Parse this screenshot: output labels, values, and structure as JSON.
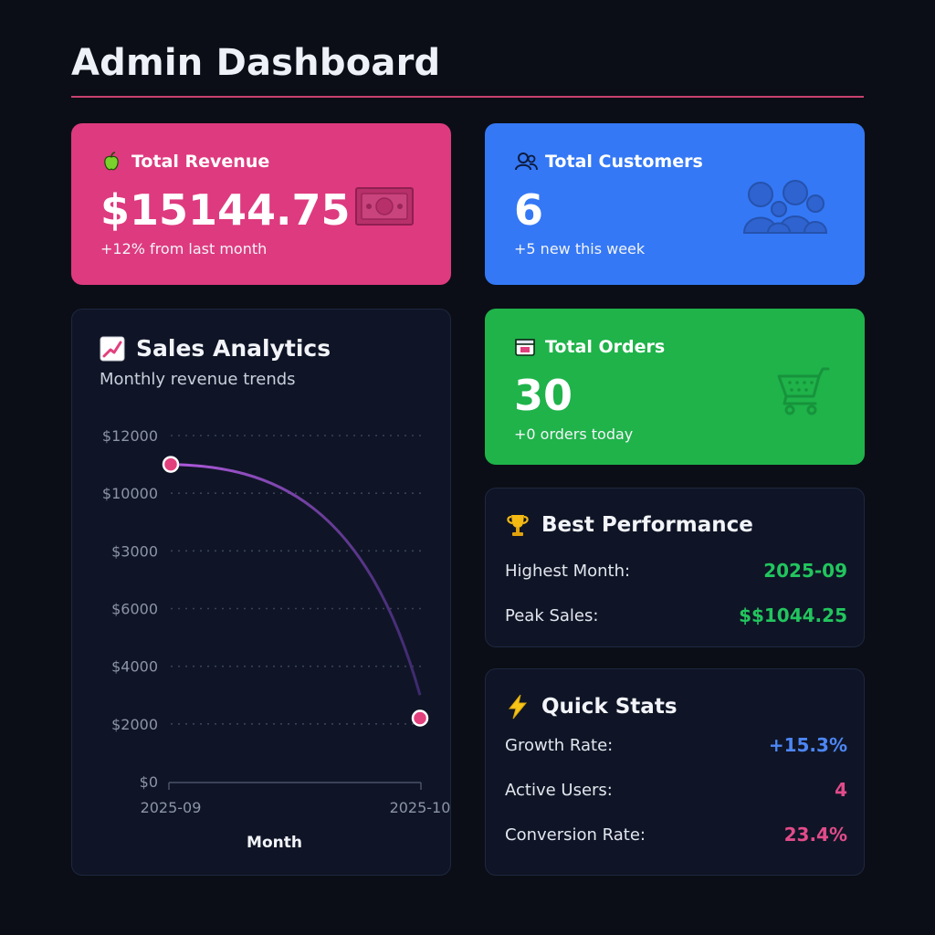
{
  "header": {
    "title": "Admin Dashboard"
  },
  "stats": {
    "revenue": {
      "title": "Total Revenue",
      "value": "$15144.75",
      "note": "+12% from last month",
      "icon": "apple-icon",
      "deco": "money-icon"
    },
    "customers": {
      "title": "Total Customers",
      "value": "6",
      "note": "+5 new this week",
      "icon": "users-icon",
      "deco": "people-group-icon"
    },
    "orders": {
      "title": "Total Orders",
      "value": "30",
      "note": "+0 orders today",
      "icon": "box-icon",
      "deco": "cart-icon"
    }
  },
  "sales": {
    "title": "Sales Analytics",
    "subtitle": "Monthly revenue trends",
    "icon": "chart-icon"
  },
  "chart_data": {
    "type": "line",
    "xlabel": "Month",
    "ylabel": "",
    "categories": [
      "2025-09",
      "2025-10"
    ],
    "y_tick_labels": [
      "$0",
      "$2000",
      "$4000",
      "$6000",
      "$3000",
      "$10000",
      "$12000"
    ],
    "y_ticks": [
      0,
      2000,
      4000,
      6000,
      8000,
      10000,
      12000
    ],
    "ylim": [
      0,
      12000
    ],
    "grid": true,
    "series": [
      {
        "values": [
          11000,
          2200
        ],
        "color": "#a052d6",
        "marker_color": "#e23f7d"
      }
    ]
  },
  "best": {
    "title": "Best Performance",
    "icon": "trophy-icon",
    "rows": [
      {
        "label": "Highest Month:",
        "value": "2025-09"
      },
      {
        "label": "Peak Sales:",
        "value": "$$1044.25"
      }
    ]
  },
  "quick": {
    "title": "Quick Stats",
    "icon": "lightning-icon",
    "rows": [
      {
        "label": "Growth Rate:",
        "value": "+15.3%"
      },
      {
        "label": "Active Users:",
        "value": "4"
      },
      {
        "label": "Conversion Rate:",
        "value": "23.4%"
      }
    ]
  },
  "colors": {
    "background": "#0b0e16",
    "revenue": "#de3a7f",
    "customers": "#3478f5",
    "orders": "#1fb34a",
    "accent_line": "#c7426f"
  }
}
